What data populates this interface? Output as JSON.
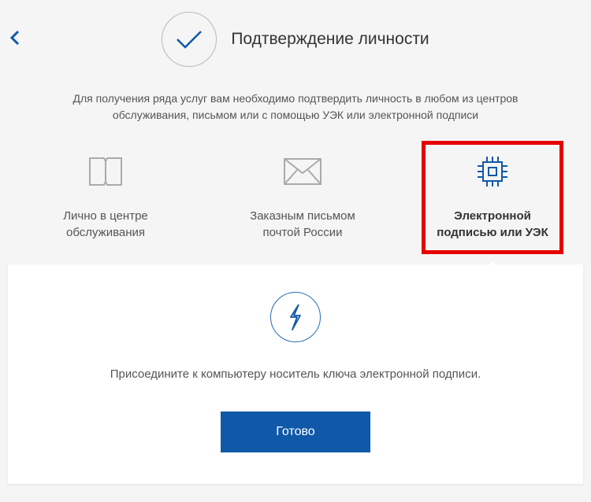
{
  "header": {
    "title": "Подтверждение личности"
  },
  "description": "Для получения ряда услуг вам необходимо подтвердить личность в любом из центров обслуживания, письмом или с помощью УЭК или электронной подписи",
  "options": [
    {
      "label": "Лично в центре обслуживания"
    },
    {
      "label": "Заказным письмом почтой России"
    },
    {
      "label": "Электронной подписью или УЭК"
    }
  ],
  "card": {
    "text": "Присоедините к компьютеру носитель ключа электронной подписи.",
    "button": "Готово"
  },
  "colors": {
    "accent": "#1058a8",
    "highlight": "#e60000"
  }
}
